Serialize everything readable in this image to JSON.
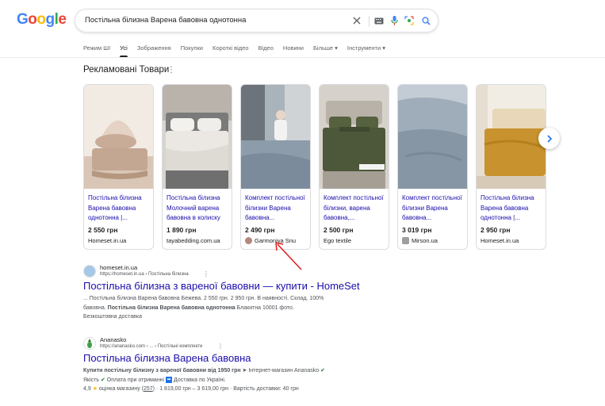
{
  "logo": {
    "letters": [
      "G",
      "o",
      "o",
      "g",
      "l",
      "e"
    ],
    "colors": [
      "#4285F4",
      "#EA4335",
      "#FBBC05",
      "#4285F4",
      "#34A853",
      "#EA4335"
    ]
  },
  "search": {
    "query": "Постільна білизна Варена бавовна однотонна"
  },
  "tabs": [
    {
      "label": "Режим ШІ"
    },
    {
      "label": "Усі"
    },
    {
      "label": "Зображення"
    },
    {
      "label": "Покупки"
    },
    {
      "label": "Короткі відео"
    },
    {
      "label": "Відео"
    },
    {
      "label": "Новини"
    },
    {
      "label": "Більше ▾"
    },
    {
      "label": "Інструменти ▾"
    }
  ],
  "ads": {
    "title": "Рекламовані Товари",
    "dots": "⋮",
    "products": [
      {
        "title": "Постільна білизна Варена бавовна однотонна |...",
        "price": "2 550 грн",
        "store": "Homeset.in.ua",
        "color_bg": "#ece4dc",
        "color_main": "#c6aa97"
      },
      {
        "title": "Постільна білизна Молочний варена бавовна в колиску",
        "price": "1 890 грн",
        "store": "tayabedding.com.ua",
        "color_bg": "#8a8a8a",
        "color_main": "#e8e4df"
      },
      {
        "title": "Комплект постільної білизни Варена бавовна...",
        "price": "2 490 грн",
        "store": "Garmoniya Snu",
        "color_bg": "#9aa7b3",
        "color_main": "#7d8fa0"
      },
      {
        "title": "Комплект постільної білизни, варена бавовна,...",
        "price": "2 500 грн",
        "store": "Ego textile",
        "color_bg": "#cfcbc4",
        "color_main": "#4f5a3c"
      },
      {
        "title": "Комплект постільної білизни Варена бавовна...",
        "price": "3 019 грн",
        "store": "Mirson.ua",
        "color_bg": "#b9c3cc",
        "color_main": "#96a5b3"
      },
      {
        "title": "Постільна білизна Варена бавовна однотонна |...",
        "price": "2 950 грн",
        "store": "Homeset.in.ua",
        "color_bg": "#ede7dc",
        "color_main": "#c9962f"
      }
    ]
  },
  "results": [
    {
      "site_name": "homeset.in.ua",
      "url": "https://homeset.in.ua › Постільна білизна",
      "title": "Постільна білизна з вареної бавовни — купити - HomeSet",
      "snippet_line1": "... Постільна білизна Варена бавовна Бежева. 2 550 грн. 2 950 грн. В наявності. Склад. 100%",
      "snippet_line2_pre": "бавовна. ",
      "snippet_line2_bold": "Постільна білизна Варена бавовна однотонна",
      "snippet_line2_post": " Блакитна 10001 фото.",
      "snippet_line3": "Безкоштовна доставка"
    },
    {
      "site_name": "Ananasko",
      "url": "https://ananasko.com › ... › Постільні комплекти",
      "title": "Постільна білизна Варена бавовна",
      "snippet_line1_bold": "Купити постільну білизну з вареної бавовни від 1950 грн",
      "snippet_line1_post": " ➤ Інтернет-магазин Ananasko ",
      "snippet_line2_pre": "Якість ",
      "snippet_line2_mid": " Оплата при отриманні ",
      "snippet_line2_post": " Доставка по Україні.",
      "rating": "4,9",
      "rating_label": " оцінка магазину (",
      "rating_count": "257",
      "rating_tail": ") · 1 819,00 грн – 3 619,00 грн · Вартість доставки: 40 грн"
    }
  ]
}
